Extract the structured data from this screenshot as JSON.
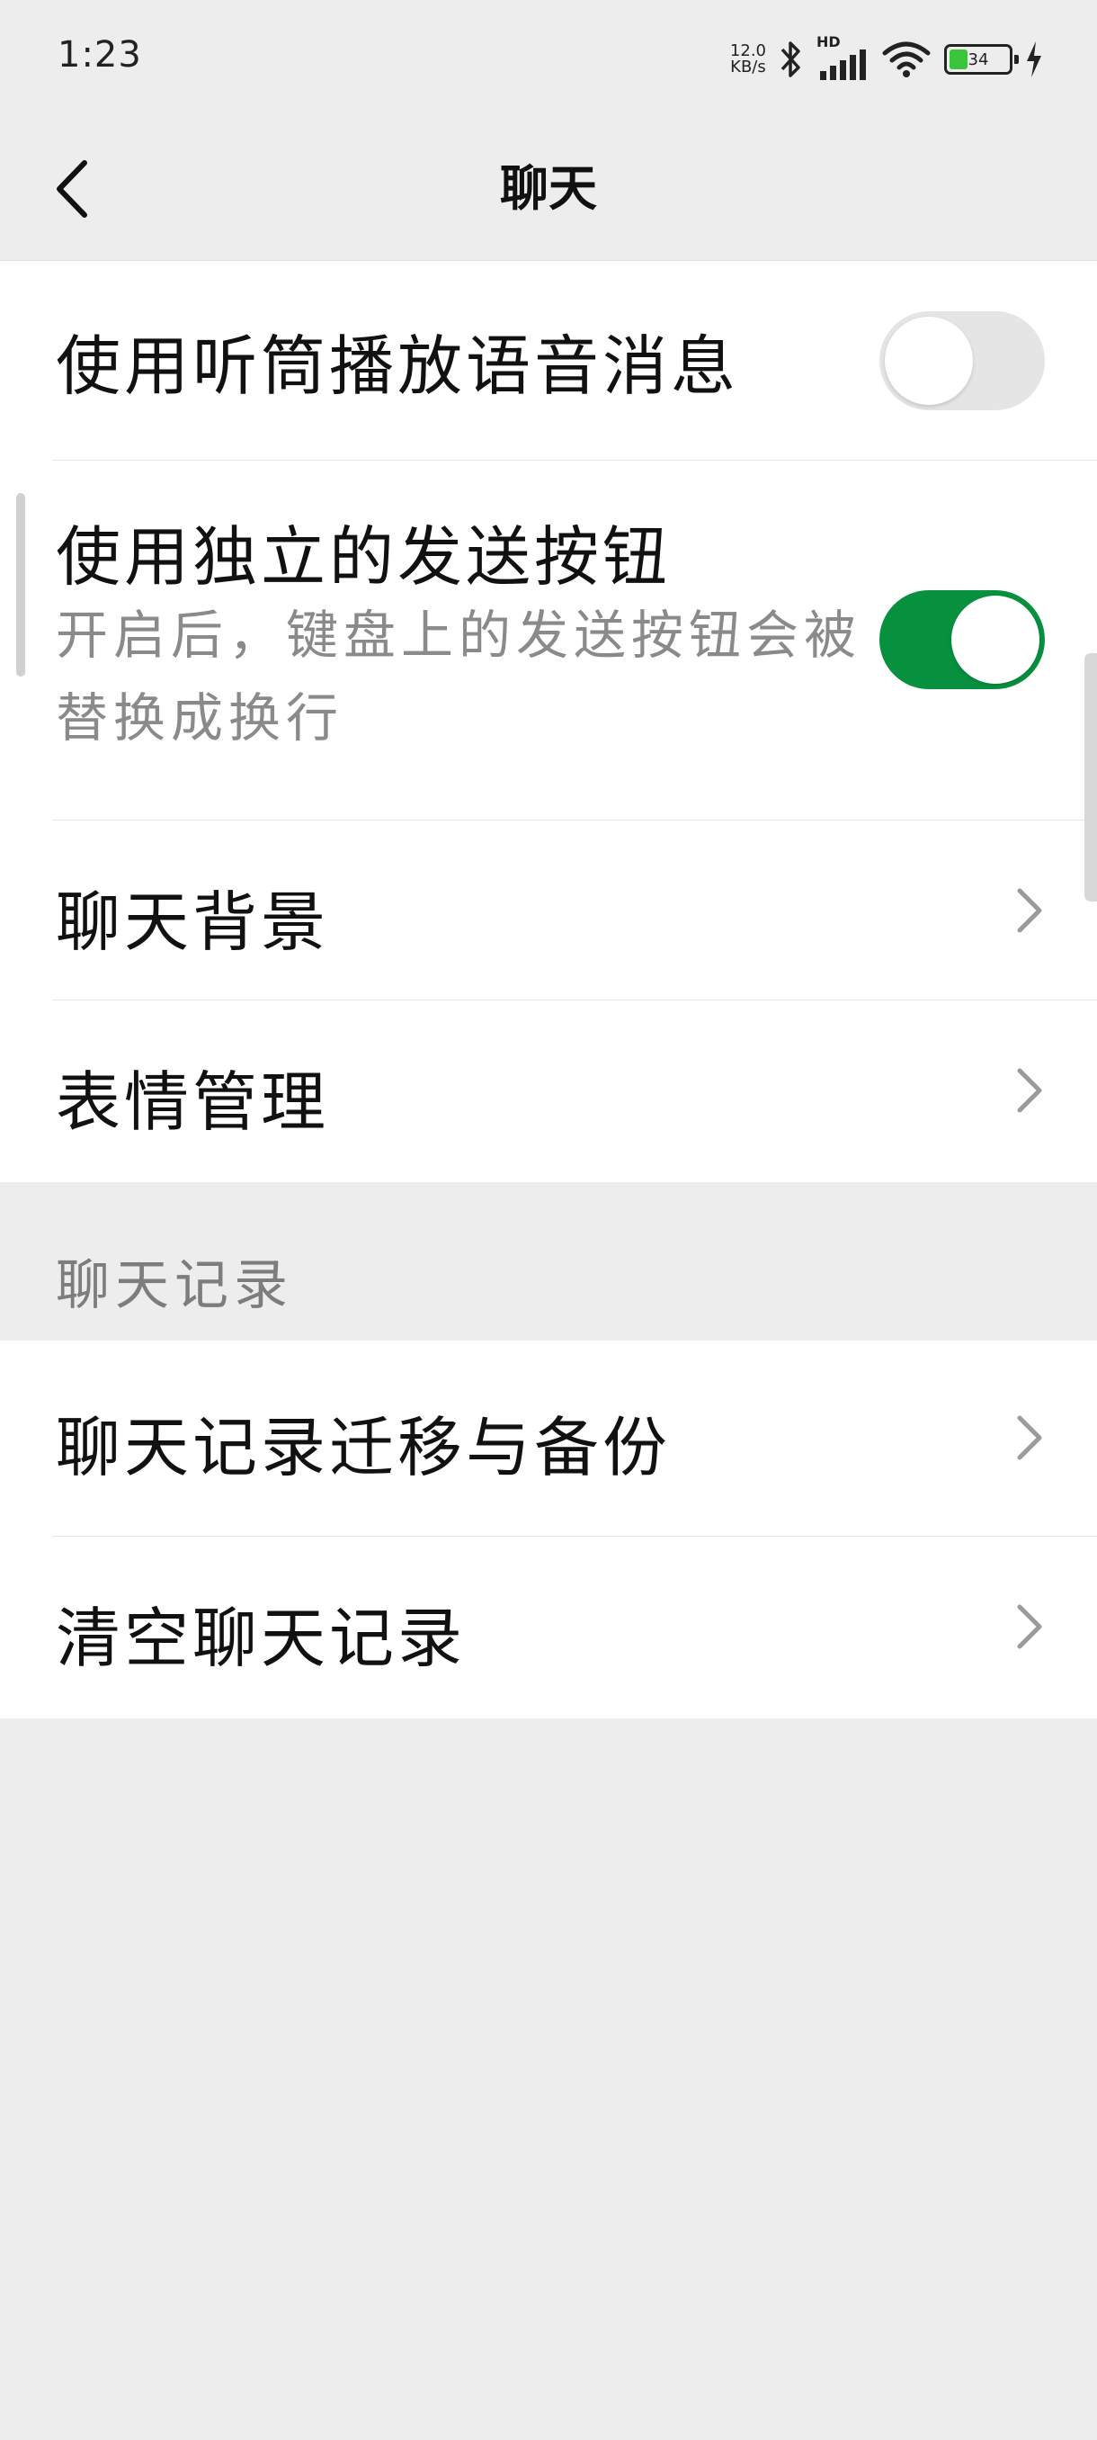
{
  "status_bar": {
    "time": "1:23",
    "net_speed_value": "12.0",
    "net_speed_unit": "KB/s",
    "hd_label": "HD",
    "battery_level": "34",
    "icons": [
      "bluetooth-icon",
      "signal-icon",
      "wifi-icon",
      "battery-icon",
      "charging-icon"
    ]
  },
  "nav": {
    "title": "聊天",
    "back_icon": "chevron-left-icon"
  },
  "settings": {
    "earpiece_playback": {
      "title": "使用听筒播放语音消息",
      "enabled": false
    },
    "separate_send_button": {
      "title": "使用独立的发送按钮",
      "description": "开启后，键盘上的发送按钮会被替换成换行",
      "enabled": true
    },
    "chat_background": {
      "title": "聊天背景"
    },
    "sticker_management": {
      "title": "表情管理"
    }
  },
  "chat_history": {
    "section_title": "聊天记录",
    "items": [
      {
        "title": "聊天记录迁移与备份"
      },
      {
        "title": "清空聊天记录"
      }
    ]
  },
  "colors": {
    "background": "#ededed",
    "accent_green": "#07913f",
    "toggle_off": "#e5e5e5"
  }
}
